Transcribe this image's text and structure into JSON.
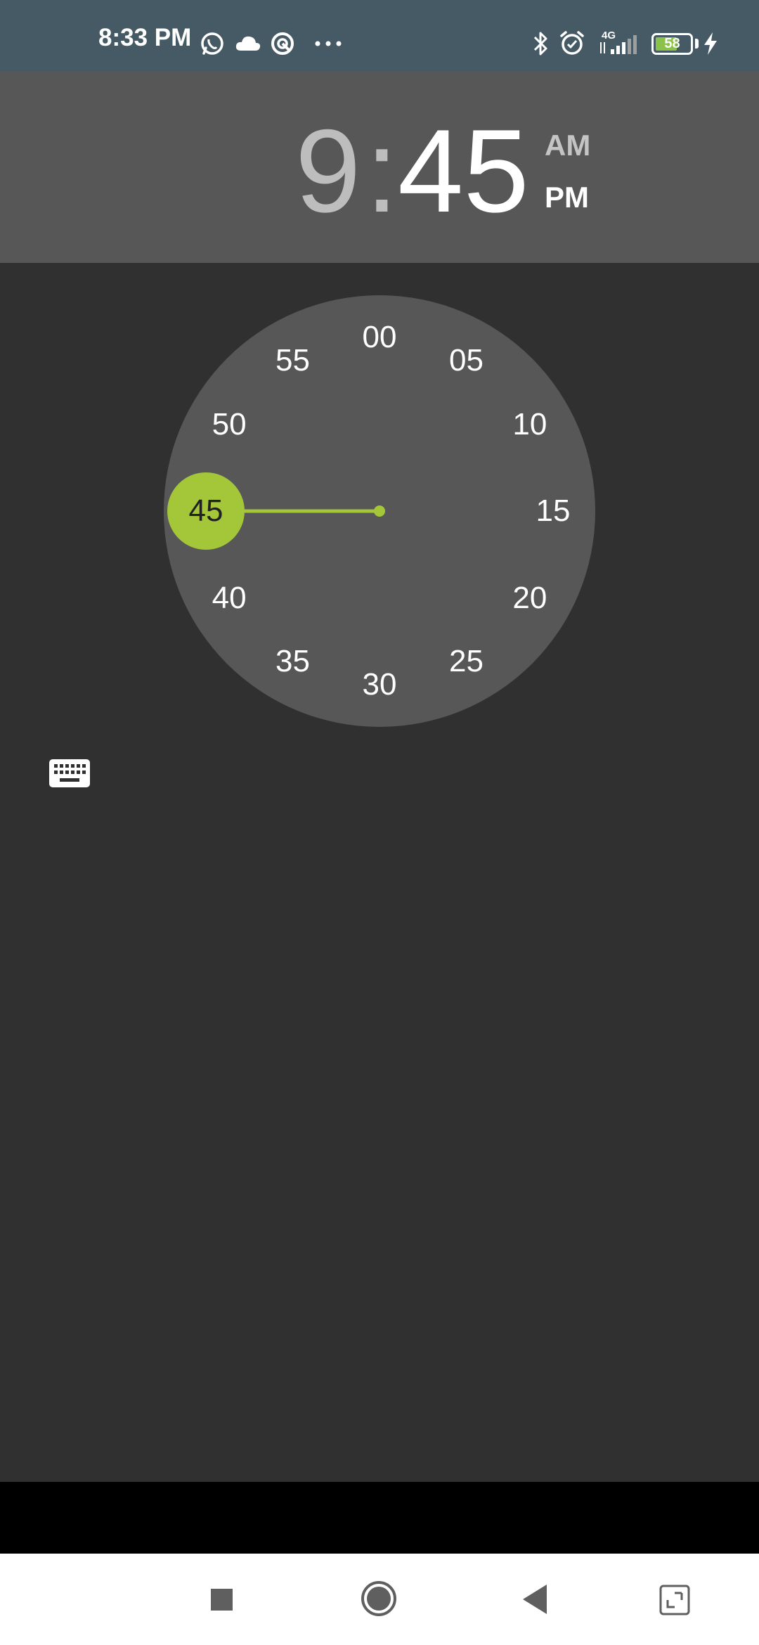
{
  "status_bar": {
    "time": "8:33 PM",
    "network": "4G",
    "battery_level": "58",
    "icons": [
      "whatsapp-icon",
      "cloud-icon",
      "sync-icon",
      "more-icon",
      "bluetooth-icon",
      "alarm-icon",
      "signal-icon",
      "battery-icon",
      "charging-icon"
    ]
  },
  "time_picker": {
    "hour": "9",
    "separator": ":",
    "minute": "45",
    "am_label": "AM",
    "pm_label": "PM",
    "selected_period": "PM",
    "selected_minute": "45"
  },
  "clock": {
    "numbers": [
      "00",
      "05",
      "10",
      "15",
      "20",
      "25",
      "30",
      "35",
      "40",
      "45",
      "50",
      "55"
    ]
  },
  "colors": {
    "status_bar": "#455a64",
    "header": "#575757",
    "background": "#303030",
    "dial": "#575757",
    "accent": "#a4c639"
  },
  "navigation": {
    "buttons": [
      "recents-icon",
      "home-icon",
      "back-icon",
      "screenshot-icon"
    ]
  }
}
